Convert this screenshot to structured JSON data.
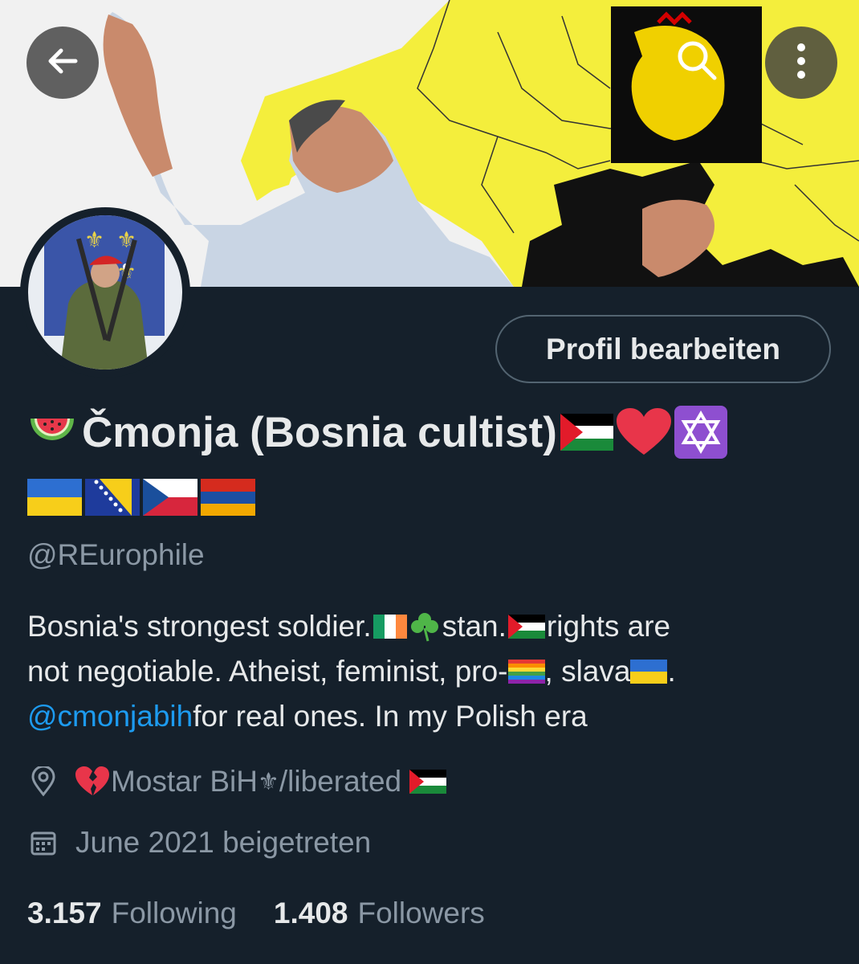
{
  "header": {
    "back_icon": "arrow-left-icon",
    "search_icon": "search-icon",
    "more_icon": "more-vertical-icon"
  },
  "profile": {
    "edit_button_label": "Profil bearbeiten",
    "display_name_text": "Čmonja (Bosnia cultist)",
    "display_name_emojis_before": [
      "watermelon"
    ],
    "display_name_emojis_after": [
      "palestine-flag",
      "red-heart",
      "star-of-david"
    ],
    "flags_row": [
      "ukraine-flag",
      "bosnia-flag",
      "czech-flag",
      "armenia-flag"
    ],
    "handle": "@REurophile",
    "bio": {
      "line1_a": "Bosnia's strongest soldier. ",
      "line1_b": "stan. ",
      "line1_c": " rights are",
      "line2_a": "not negotiable. Atheist, feminist, pro-",
      "line2_b": ", slava ",
      "line2_c": ".",
      "mention": "@cmonjabih",
      "line3_rest": " for real ones. In my Polish era"
    },
    "location_pre": "Mostar BiH",
    "location_post": "/liberated ",
    "joined": "June 2021 beigetreten",
    "following_count": "3.157",
    "following_label": "Following",
    "followers_count": "1.408",
    "followers_label": "Followers"
  },
  "colors": {
    "background": "#15202b",
    "text": "#e7e9ea",
    "muted": "#8b98a5",
    "link": "#1d9bf0"
  }
}
